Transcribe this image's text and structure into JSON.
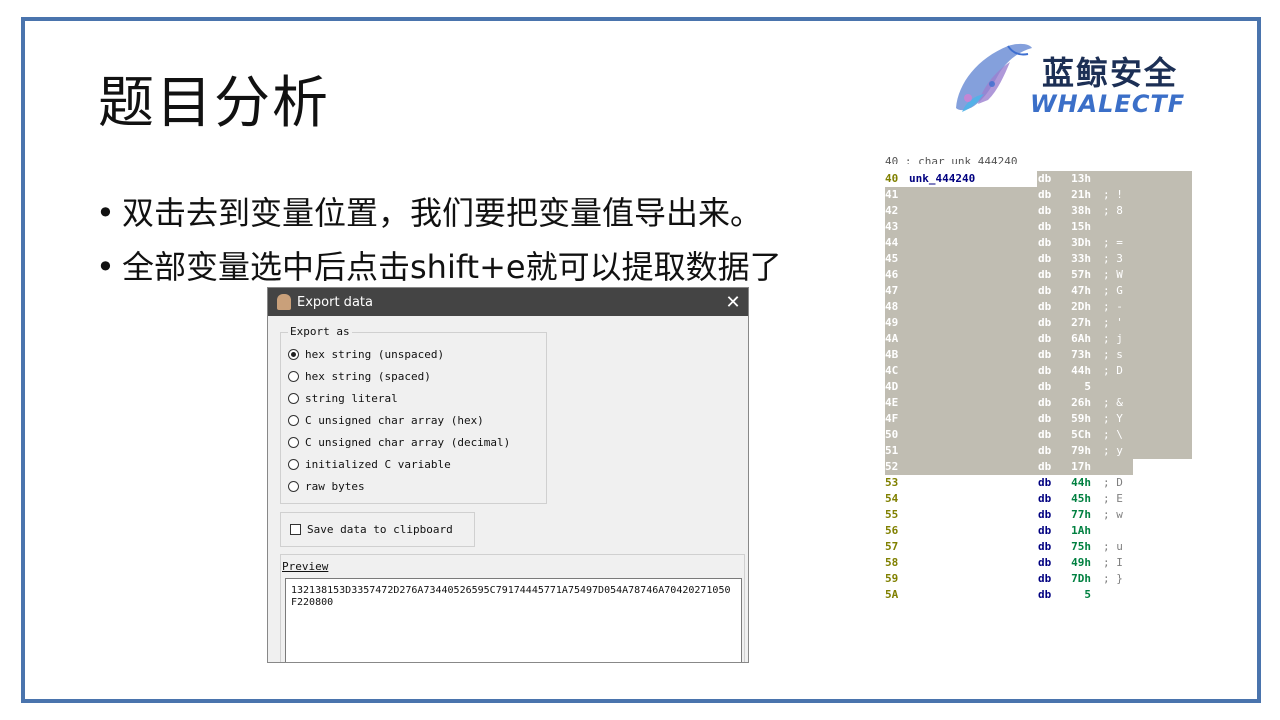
{
  "slide": {
    "title": "题目分析",
    "bullets": [
      "双击去到变量位置，我们要把变量值导出来。",
      "全部变量选中后点击shift+e就可以提取数据了"
    ],
    "bullet_char": "•"
  },
  "logo": {
    "cn": "蓝鲸安全",
    "en": "WHALECTF",
    "icon": "whale-icon"
  },
  "dialog": {
    "title": "Export data",
    "close_icon": "✕",
    "export_as_label": "Export as",
    "options": [
      {
        "label": "hex string (unspaced)",
        "selected": true
      },
      {
        "label": "hex string (spaced)",
        "selected": false
      },
      {
        "label": "string literal",
        "selected": false
      },
      {
        "label": "C unsigned char array (hex)",
        "selected": false
      },
      {
        "label": "C unsigned char array (decimal)",
        "selected": false
      },
      {
        "label": "initialized C variable",
        "selected": false
      },
      {
        "label": "raw bytes",
        "selected": false
      }
    ],
    "clipboard_label": "Save data to clipboard",
    "clipboard_checked": false,
    "preview_label": "Preview",
    "preview_text": "132138153D3357472D276A73440526595C79174445771A75497D054A78746A70420271050F220800"
  },
  "ida": {
    "top_partial": "40 ; char unk_444240",
    "rows": [
      {
        "addr": "40",
        "label": "unk_444240",
        "db": "db",
        "val": "13h",
        "cmt": "",
        "sel": "partial"
      },
      {
        "addr": "41",
        "label": "",
        "db": "db",
        "val": "21h",
        "cmt": "; !",
        "sel": "full"
      },
      {
        "addr": "42",
        "label": "",
        "db": "db",
        "val": "38h",
        "cmt": "; 8",
        "sel": "full"
      },
      {
        "addr": "43",
        "label": "",
        "db": "db",
        "val": "15h",
        "cmt": "",
        "sel": "full"
      },
      {
        "addr": "44",
        "label": "",
        "db": "db",
        "val": "3Dh",
        "cmt": "; =",
        "sel": "full"
      },
      {
        "addr": "45",
        "label": "",
        "db": "db",
        "val": "33h",
        "cmt": "; 3",
        "sel": "full"
      },
      {
        "addr": "46",
        "label": "",
        "db": "db",
        "val": "57h",
        "cmt": "; W",
        "sel": "full"
      },
      {
        "addr": "47",
        "label": "",
        "db": "db",
        "val": "47h",
        "cmt": "; G",
        "sel": "full"
      },
      {
        "addr": "48",
        "label": "",
        "db": "db",
        "val": "2Dh",
        "cmt": "; -",
        "sel": "full"
      },
      {
        "addr": "49",
        "label": "",
        "db": "db",
        "val": "27h",
        "cmt": "; '",
        "sel": "full"
      },
      {
        "addr": "4A",
        "label": "",
        "db": "db",
        "val": "6Ah",
        "cmt": "; j",
        "sel": "full"
      },
      {
        "addr": "4B",
        "label": "",
        "db": "db",
        "val": "73h",
        "cmt": "; s",
        "sel": "full"
      },
      {
        "addr": "4C",
        "label": "",
        "db": "db",
        "val": "44h",
        "cmt": "; D",
        "sel": "full"
      },
      {
        "addr": "4D",
        "label": "",
        "db": "db",
        "val": "5",
        "cmt": "",
        "sel": "full"
      },
      {
        "addr": "4E",
        "label": "",
        "db": "db",
        "val": "26h",
        "cmt": "; &",
        "sel": "full"
      },
      {
        "addr": "4F",
        "label": "",
        "db": "db",
        "val": "59h",
        "cmt": "; Y",
        "sel": "full"
      },
      {
        "addr": "50",
        "label": "",
        "db": "db",
        "val": "5Ch",
        "cmt": "; \\",
        "sel": "full"
      },
      {
        "addr": "51",
        "label": "",
        "db": "db",
        "val": "79h",
        "cmt": "; y",
        "sel": "full"
      },
      {
        "addr": "52",
        "label": "",
        "db": "db",
        "val": "17h",
        "cmt": "",
        "sel": "end"
      },
      {
        "addr": "53",
        "label": "",
        "db": "db",
        "val": "44h",
        "cmt": "; D",
        "sel": "none"
      },
      {
        "addr": "54",
        "label": "",
        "db": "db",
        "val": "45h",
        "cmt": "; E",
        "sel": "none"
      },
      {
        "addr": "55",
        "label": "",
        "db": "db",
        "val": "77h",
        "cmt": "; w",
        "sel": "none"
      },
      {
        "addr": "56",
        "label": "",
        "db": "db",
        "val": "1Ah",
        "cmt": "",
        "sel": "none"
      },
      {
        "addr": "57",
        "label": "",
        "db": "db",
        "val": "75h",
        "cmt": "; u",
        "sel": "none"
      },
      {
        "addr": "58",
        "label": "",
        "db": "db",
        "val": "49h",
        "cmt": "; I",
        "sel": "none"
      },
      {
        "addr": "59",
        "label": "",
        "db": "db",
        "val": "7Dh",
        "cmt": "; }",
        "sel": "none"
      },
      {
        "addr": "5A",
        "label": "",
        "db": "db",
        "val": "5",
        "cmt": "",
        "sel": "none"
      }
    ]
  },
  "colors": {
    "frame": "#4a74ad",
    "selection": "#c0bdb2",
    "addr_selected": "#ffffff",
    "addr_normal": "#808000",
    "db_color": "#000080",
    "val_selected": "#ffffff",
    "val_normal": "#008040",
    "cmt_selected": "#ffffff",
    "cmt_normal": "#808080"
  }
}
